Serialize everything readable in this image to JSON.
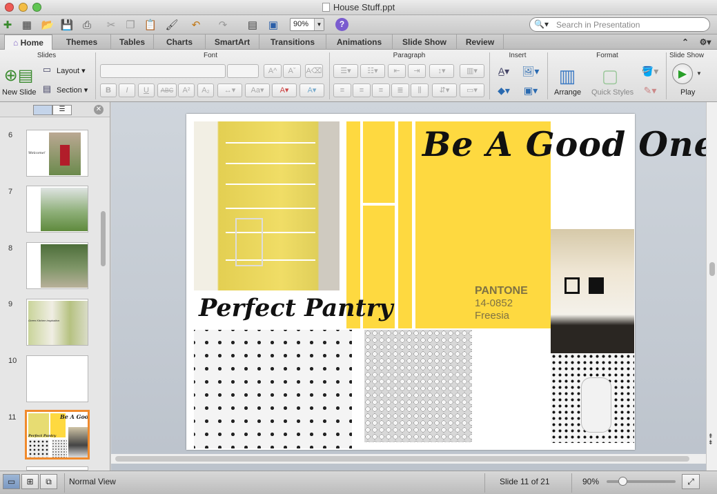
{
  "window": {
    "title": "House Stuff.ppt"
  },
  "toolbar": {
    "zoom": "90%",
    "search_placeholder": "Search in Presentation",
    "help": "?"
  },
  "tabs": [
    "Home",
    "Themes",
    "Tables",
    "Charts",
    "SmartArt",
    "Transitions",
    "Animations",
    "Slide Show",
    "Review"
  ],
  "ribbon": {
    "groups": {
      "slides": "Slides",
      "font": "Font",
      "paragraph": "Paragraph",
      "insert": "Insert",
      "format": "Format",
      "slideshow": "Slide Show"
    },
    "new_slide": "New Slide",
    "layout": "Layout",
    "section": "Section",
    "arrange": "Arrange",
    "quick_styles": "Quick Styles",
    "play": "Play",
    "font_buttons": [
      "B",
      "I",
      "U",
      "ABC",
      "A²",
      "A₂"
    ]
  },
  "slides_pane": {
    "thumbs": [
      {
        "num": "6",
        "label": "Welcome!"
      },
      {
        "num": "7"
      },
      {
        "num": "8"
      },
      {
        "num": "9",
        "label": "Green Kitchen inspiration"
      },
      {
        "num": "10"
      },
      {
        "num": "11",
        "label": "Be A Good One",
        "sub": "Perfect Pantry"
      }
    ]
  },
  "slide": {
    "title": "Be A Good One",
    "pantry_caption": "Perfect Pantry",
    "pantone": {
      "brand": "PANTONE",
      "code": "14-0852",
      "name": "Freesia"
    }
  },
  "colors": {
    "freesia": "#fed940",
    "selection": "#f08a2c"
  },
  "status": {
    "view": "Normal View",
    "slide_pos": "Slide 11 of 21",
    "zoom": "90%"
  }
}
